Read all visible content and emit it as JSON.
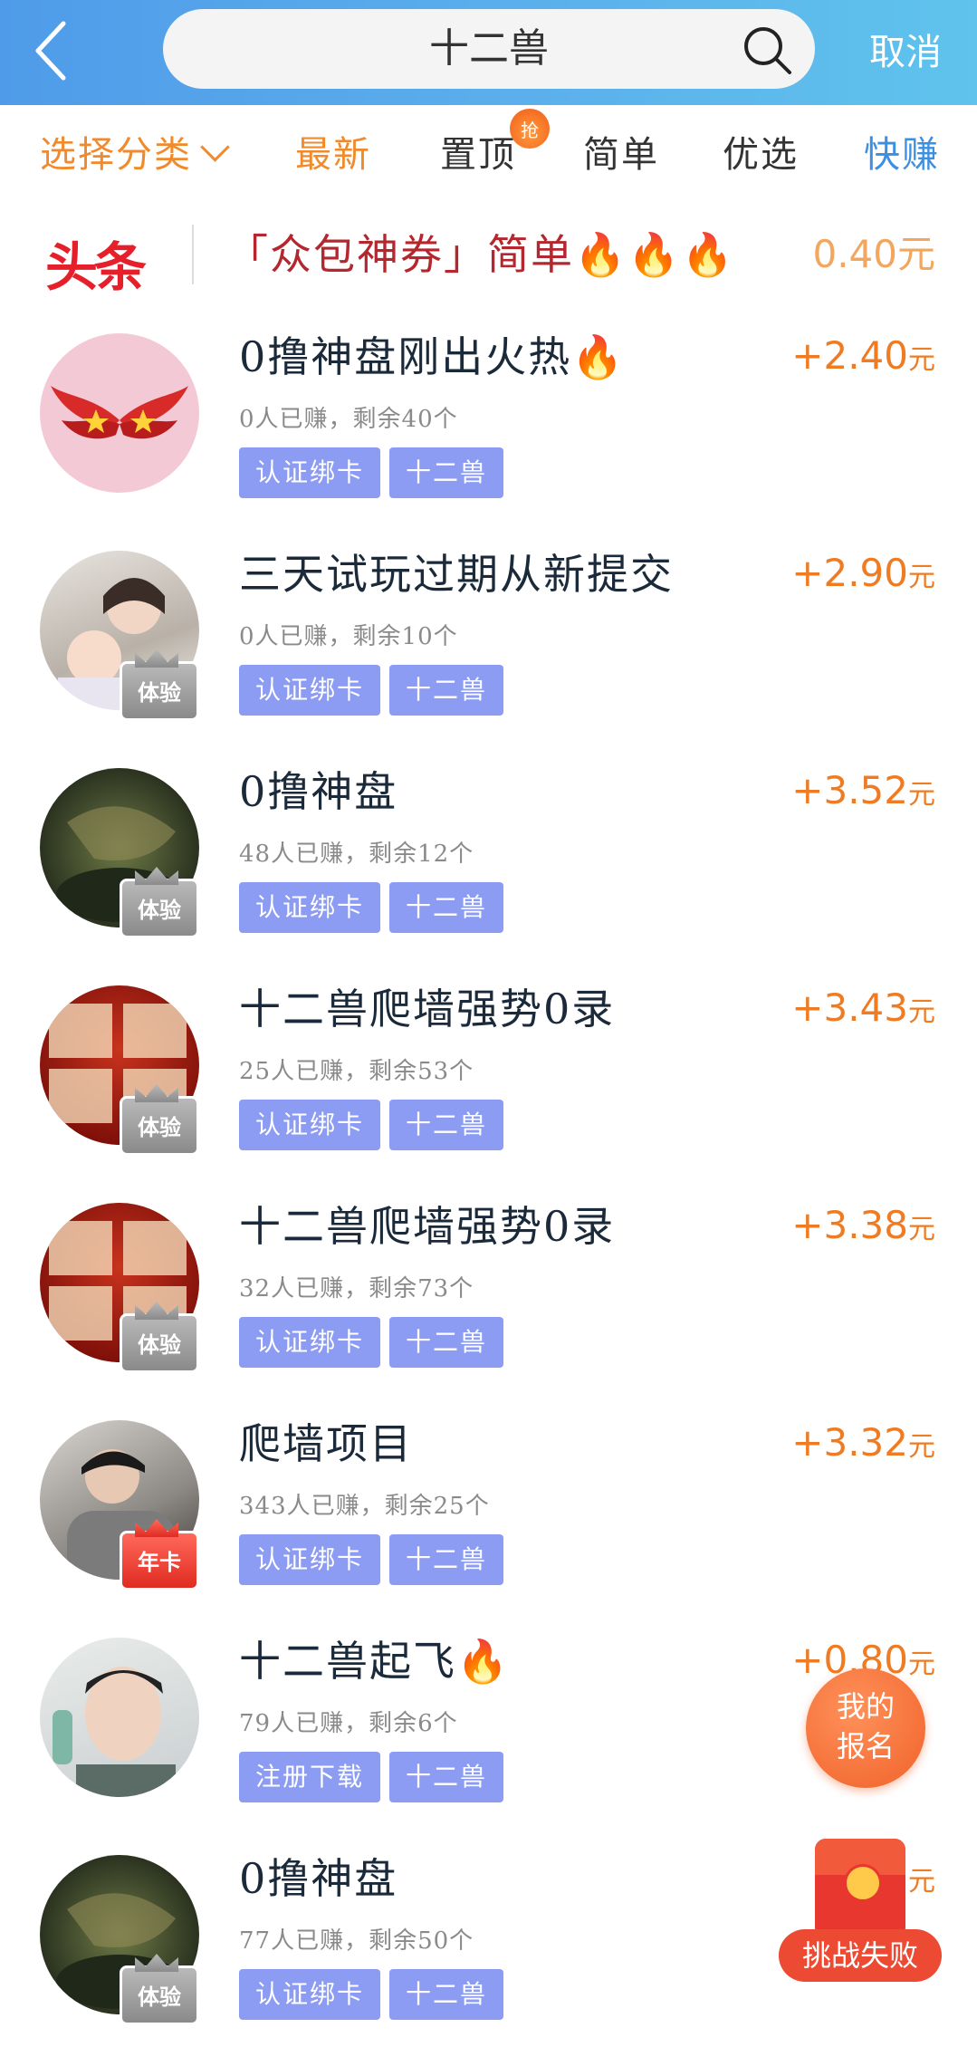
{
  "header": {
    "search_value": "十二兽",
    "cancel_label": "取消"
  },
  "filters": {
    "category": "选择分类",
    "latest": "最新",
    "pinned": "置顶",
    "pinned_badge": "抢",
    "simple": "简单",
    "preferred": "优选",
    "quick_earn": "快赚"
  },
  "headline": {
    "logo": "头条",
    "text": "「众包神券」简单🔥🔥🔥",
    "price": "0.40元"
  },
  "tasks": [
    {
      "title": "0撸神盘刚出火热🔥",
      "meta": "0人已赚，剩余40个",
      "tags": [
        "认证绑卡",
        "十二兽"
      ],
      "price": "+2.40",
      "unit": "元",
      "badge": ""
    },
    {
      "title": "三天试玩过期从新提交",
      "meta": "0人已赚，剩余10个",
      "tags": [
        "认证绑卡",
        "十二兽"
      ],
      "price": "+2.90",
      "unit": "元",
      "badge": "体验"
    },
    {
      "title": "0撸神盘",
      "meta": "48人已赚，剩余12个",
      "tags": [
        "认证绑卡",
        "十二兽"
      ],
      "price": "+3.52",
      "unit": "元",
      "badge": "体验"
    },
    {
      "title": "十二兽爬墙强势0录",
      "meta": "25人已赚，剩余53个",
      "tags": [
        "认证绑卡",
        "十二兽"
      ],
      "price": "+3.43",
      "unit": "元",
      "badge": "体验"
    },
    {
      "title": "十二兽爬墙强势0录",
      "meta": "32人已赚，剩余73个",
      "tags": [
        "认证绑卡",
        "十二兽"
      ],
      "price": "+3.38",
      "unit": "元",
      "badge": "体验"
    },
    {
      "title": "爬墙项目",
      "meta": "343人已赚，剩余25个",
      "tags": [
        "认证绑卡",
        "十二兽"
      ],
      "price": "+3.32",
      "unit": "元",
      "badge": "年卡"
    },
    {
      "title": "十二兽起飞🔥",
      "meta": "79人已赚，剩余6个",
      "tags": [
        "注册下载",
        "十二兽"
      ],
      "price": "+0.80",
      "unit": "元",
      "badge": ""
    },
    {
      "title": "0撸神盘",
      "meta": "77人已赚，剩余50个",
      "tags": [
        "认证绑卡",
        "十二兽"
      ],
      "price": "",
      "unit": "元",
      "badge": "体验"
    }
  ],
  "floating": {
    "signup_line1": "我的",
    "signup_line2": "报名",
    "challenge_label": "挑战失败"
  },
  "colors": {
    "header_gradient_start": "#4f9be9",
    "accent_orange": "#ef7b22",
    "tag_blue": "#8d9cf3",
    "headline_red": "#b4272e"
  }
}
